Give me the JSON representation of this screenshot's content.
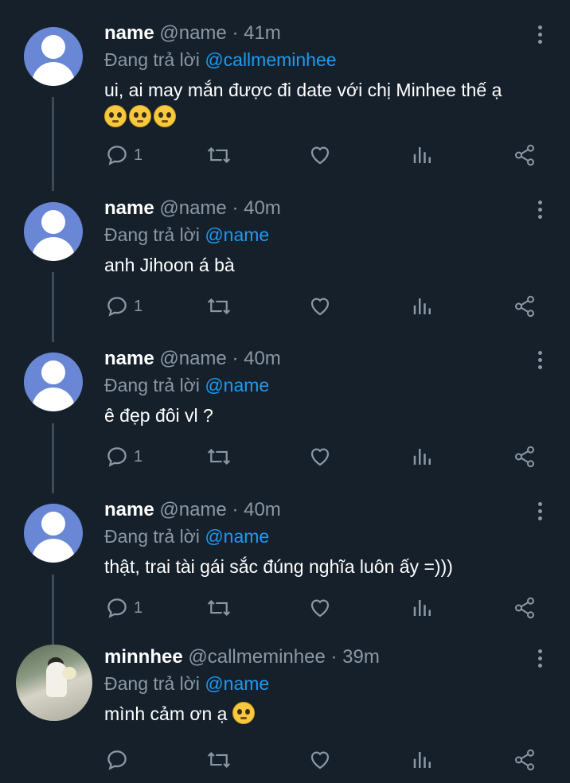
{
  "tweets": [
    {
      "name": "name",
      "handle": "@name",
      "time": "41m",
      "reply_prefix": "Đang trả lời",
      "reply_to": "@callmeminhee",
      "text": "ui, ai may mắn được đi date với chị Minhee thế ạ",
      "emoji": [
        "pleading-face",
        "pleading-face",
        "pleading-face"
      ],
      "reply_count": "1"
    },
    {
      "name": "name",
      "handle": "@name",
      "time": "40m",
      "reply_prefix": "Đang trả lời",
      "reply_to": "@name",
      "text": "anh Jihoon á bà",
      "reply_count": "1"
    },
    {
      "name": "name",
      "handle": "@name",
      "time": "40m",
      "reply_prefix": "Đang trả lời",
      "reply_to": "@name",
      "text": "ê đẹp đôi vl ?",
      "reply_count": "1"
    },
    {
      "name": "name",
      "handle": "@name",
      "time": "40m",
      "reply_prefix": "Đang trả lời",
      "reply_to": "@name",
      "text": "thật, trai tài gái sắc đúng nghĩa luôn ấy =)))",
      "reply_count": "1"
    },
    {
      "name": "minnhee",
      "handle": "@callmeminhee",
      "time": "39m",
      "reply_prefix": "Đang trả lời",
      "reply_to": "@name",
      "text": "mình cảm ơn ạ",
      "emoji": [
        "pleading-face"
      ],
      "reply_count": ""
    }
  ],
  "separator": " · ",
  "colors": {
    "background": "#15202b",
    "mention": "#1d9bf0",
    "muted": "#8b98a5",
    "default_avatar": "#6a87d6"
  },
  "icons": [
    "reply-icon",
    "retweet-icon",
    "like-icon",
    "analytics-icon",
    "share-icon",
    "more-icon",
    "pleading-face-emoji"
  ]
}
